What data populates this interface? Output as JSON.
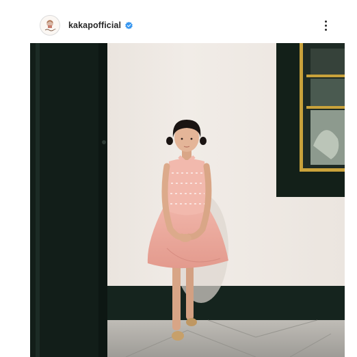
{
  "post": {
    "username": "kakapofficial",
    "verified": true,
    "avatar_icon": "brand-logo-avatar",
    "more_icon": "more-options-icon",
    "image_subject": "photo-girl-pink-dress"
  },
  "colors": {
    "verified_badge": "#3897f0",
    "text": "#262626",
    "wall": "#ece6e1",
    "door": "#14211c",
    "frame_gold": "#c9a23b",
    "dress_pink": "#e9a69a"
  }
}
